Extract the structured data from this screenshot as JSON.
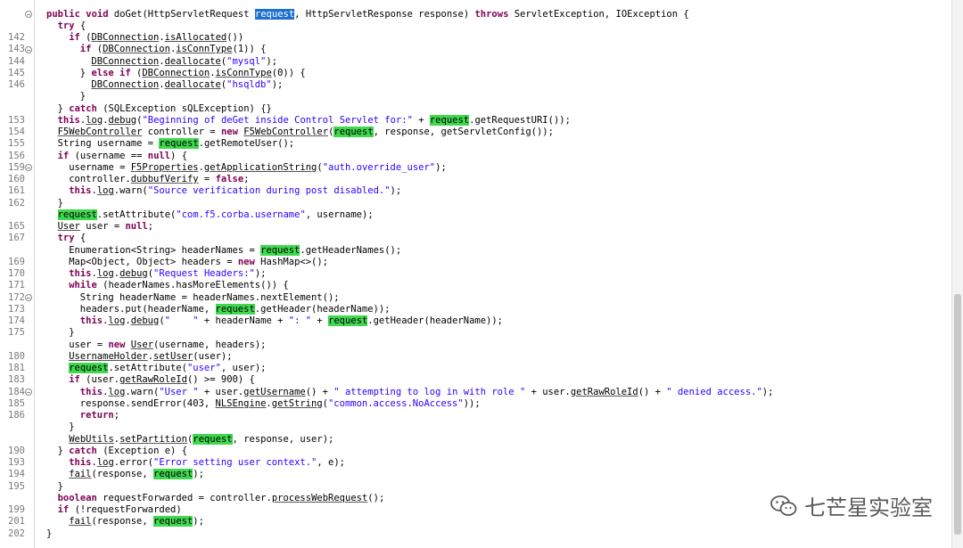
{
  "gutter": {
    "lines": [
      {
        "no": "",
        "fold": true
      },
      {
        "no": "",
        "fold": false
      },
      {
        "no": "142",
        "fold": false
      },
      {
        "no": "143",
        "fold": true
      },
      {
        "no": "144",
        "fold": false
      },
      {
        "no": "145",
        "fold": false
      },
      {
        "no": "146",
        "fold": false
      },
      {
        "no": "",
        "fold": false
      },
      {
        "no": "",
        "fold": false
      },
      {
        "no": "153",
        "fold": false
      },
      {
        "no": "154",
        "fold": false
      },
      {
        "no": "155",
        "fold": false
      },
      {
        "no": "156",
        "fold": false
      },
      {
        "no": "159",
        "fold": true
      },
      {
        "no": "160",
        "fold": false
      },
      {
        "no": "161",
        "fold": false
      },
      {
        "no": "162",
        "fold": false
      },
      {
        "no": "",
        "fold": false
      },
      {
        "no": "165",
        "fold": false
      },
      {
        "no": "167",
        "fold": false
      },
      {
        "no": "",
        "fold": false
      },
      {
        "no": "169",
        "fold": false
      },
      {
        "no": "170",
        "fold": false
      },
      {
        "no": "171",
        "fold": false
      },
      {
        "no": "172",
        "fold": true
      },
      {
        "no": "173",
        "fold": false
      },
      {
        "no": "174",
        "fold": false
      },
      {
        "no": "175",
        "fold": false
      },
      {
        "no": "",
        "fold": false
      },
      {
        "no": "180",
        "fold": false
      },
      {
        "no": "181",
        "fold": false
      },
      {
        "no": "183",
        "fold": false
      },
      {
        "no": "184",
        "fold": true
      },
      {
        "no": "185",
        "fold": false
      },
      {
        "no": "186",
        "fold": false
      },
      {
        "no": "",
        "fold": false
      },
      {
        "no": "",
        "fold": false
      },
      {
        "no": "190",
        "fold": false
      },
      {
        "no": "193",
        "fold": false
      },
      {
        "no": "194",
        "fold": false
      },
      {
        "no": "195",
        "fold": false
      },
      {
        "no": "",
        "fold": false
      },
      {
        "no": "199",
        "fold": false
      },
      {
        "no": "201",
        "fold": false
      },
      {
        "no": "202",
        "fold": false
      },
      {
        "no": "",
        "fold": false
      }
    ]
  },
  "code": {
    "rows": [
      {
        "indent": 0,
        "parts": [
          [
            "public void ",
            "k"
          ],
          [
            "doGet(HttpServletRequest ",
            ""
          ],
          [
            "request",
            "sel"
          ],
          [
            ", HttpServletResponse response) ",
            ""
          ],
          [
            "throws ",
            "k"
          ],
          [
            "ServletException, IOException {",
            ""
          ]
        ]
      },
      {
        "indent": 1,
        "parts": [
          [
            "try ",
            "k"
          ],
          [
            "{",
            ""
          ]
        ]
      },
      {
        "indent": 2,
        "parts": [
          [
            "if ",
            "k"
          ],
          [
            "(",
            ""
          ],
          [
            "DBConnection",
            "u"
          ],
          [
            ".",
            ""
          ],
          [
            "isAllocated",
            "u"
          ],
          [
            "())",
            ""
          ]
        ]
      },
      {
        "indent": 3,
        "parts": [
          [
            "if ",
            "k"
          ],
          [
            "(",
            ""
          ],
          [
            "DBConnection",
            "u"
          ],
          [
            ".",
            ""
          ],
          [
            "isConnType",
            "u"
          ],
          [
            "(1)) {",
            ""
          ]
        ]
      },
      {
        "indent": 4,
        "parts": [
          [
            "DBConnection",
            "u"
          ],
          [
            ".",
            ""
          ],
          [
            "deallocate",
            "u"
          ],
          [
            "(",
            ""
          ],
          [
            "\"mysql\"",
            "s"
          ],
          [
            ");",
            ""
          ]
        ]
      },
      {
        "indent": 3,
        "parts": [
          [
            "} ",
            ""
          ],
          [
            "else if ",
            "k"
          ],
          [
            "(",
            ""
          ],
          [
            "DBConnection",
            "u"
          ],
          [
            ".",
            ""
          ],
          [
            "isConnType",
            "u"
          ],
          [
            "(0)) {",
            ""
          ]
        ]
      },
      {
        "indent": 4,
        "parts": [
          [
            "DBConnection",
            "u"
          ],
          [
            ".",
            ""
          ],
          [
            "deallocate",
            "u"
          ],
          [
            "(",
            ""
          ],
          [
            "\"hsqldb\"",
            "s"
          ],
          [
            ");",
            ""
          ]
        ]
      },
      {
        "indent": 3,
        "parts": [
          [
            "}",
            ""
          ]
        ]
      },
      {
        "indent": 1,
        "parts": [
          [
            "} ",
            ""
          ],
          [
            "catch ",
            "k"
          ],
          [
            "(SQLException sQLException) {}",
            ""
          ]
        ]
      },
      {
        "indent": 1,
        "parts": [
          [
            "this",
            "k"
          ],
          [
            ".",
            ""
          ],
          [
            "log",
            "u"
          ],
          [
            ".",
            ""
          ],
          [
            "debug",
            "u"
          ],
          [
            "(",
            ""
          ],
          [
            "\"Beginning of deGet inside Control Servlet for:\"",
            "s"
          ],
          [
            " + ",
            ""
          ],
          [
            "request",
            "hl"
          ],
          [
            ".getRequestURI());",
            ""
          ]
        ]
      },
      {
        "indent": 1,
        "parts": [
          [
            "F5WebController",
            "u"
          ],
          [
            " controller = ",
            ""
          ],
          [
            "new ",
            "k"
          ],
          [
            "F5WebController",
            "u"
          ],
          [
            "(",
            ""
          ],
          [
            "request",
            "hl"
          ],
          [
            ", response, getServletConfig());",
            ""
          ]
        ]
      },
      {
        "indent": 1,
        "parts": [
          [
            "String username = ",
            ""
          ],
          [
            "request",
            "hl"
          ],
          [
            ".getRemoteUser();",
            ""
          ]
        ]
      },
      {
        "indent": 1,
        "parts": [
          [
            "if ",
            "k"
          ],
          [
            "(username == ",
            ""
          ],
          [
            "null",
            "k"
          ],
          [
            ") {",
            ""
          ]
        ]
      },
      {
        "indent": 2,
        "parts": [
          [
            "username = ",
            ""
          ],
          [
            "F5Properties",
            "u"
          ],
          [
            ".",
            ""
          ],
          [
            "getApplicationString",
            "u"
          ],
          [
            "(",
            ""
          ],
          [
            "\"auth.override_user\"",
            "s"
          ],
          [
            ");",
            ""
          ]
        ]
      },
      {
        "indent": 2,
        "parts": [
          [
            "controller.",
            ""
          ],
          [
            "dubbufVerify",
            "u"
          ],
          [
            " = ",
            ""
          ],
          [
            "false",
            "k"
          ],
          [
            ";",
            ""
          ]
        ]
      },
      {
        "indent": 2,
        "parts": [
          [
            "this",
            "k"
          ],
          [
            ".",
            ""
          ],
          [
            "log",
            "u"
          ],
          [
            ".warn(",
            ""
          ],
          [
            "\"Source verification during post disabled.\"",
            "s"
          ],
          [
            ");",
            ""
          ]
        ]
      },
      {
        "indent": 1,
        "parts": [
          [
            "}",
            ""
          ]
        ]
      },
      {
        "indent": 1,
        "parts": [
          [
            "request",
            "hl"
          ],
          [
            ".setAttribute(",
            ""
          ],
          [
            "\"com.f5.corba.username\"",
            "s"
          ],
          [
            ", username);",
            ""
          ]
        ]
      },
      {
        "indent": 1,
        "parts": [
          [
            "User",
            "u"
          ],
          [
            " user = ",
            ""
          ],
          [
            "null",
            "k"
          ],
          [
            ";",
            ""
          ]
        ]
      },
      {
        "indent": 1,
        "parts": [
          [
            "try ",
            "k"
          ],
          [
            "{",
            ""
          ]
        ]
      },
      {
        "indent": 2,
        "parts": [
          [
            "Enumeration<String> headerNames = ",
            ""
          ],
          [
            "request",
            "hl"
          ],
          [
            ".getHeaderNames();",
            ""
          ]
        ]
      },
      {
        "indent": 2,
        "parts": [
          [
            "Map<Object, Object> headers = ",
            ""
          ],
          [
            "new ",
            "k"
          ],
          [
            "HashMap<>();",
            ""
          ]
        ]
      },
      {
        "indent": 2,
        "parts": [
          [
            "this",
            "k"
          ],
          [
            ".",
            ""
          ],
          [
            "log",
            "u"
          ],
          [
            ".",
            ""
          ],
          [
            "debug",
            "u"
          ],
          [
            "(",
            ""
          ],
          [
            "\"Request Headers:\"",
            "s"
          ],
          [
            ");",
            ""
          ]
        ]
      },
      {
        "indent": 2,
        "parts": [
          [
            "while ",
            "k"
          ],
          [
            "(headerNames.hasMoreElements()) {",
            ""
          ]
        ]
      },
      {
        "indent": 3,
        "parts": [
          [
            "String headerName = headerNames.nextElement();",
            ""
          ]
        ]
      },
      {
        "indent": 3,
        "parts": [
          [
            "headers.put(headerName, ",
            ""
          ],
          [
            "request",
            "hl"
          ],
          [
            ".getHeader(headerName));",
            ""
          ]
        ]
      },
      {
        "indent": 3,
        "parts": [
          [
            "this",
            "k"
          ],
          [
            ".",
            ""
          ],
          [
            "log",
            "u"
          ],
          [
            ".",
            ""
          ],
          [
            "debug",
            "u"
          ],
          [
            "(",
            ""
          ],
          [
            "\"    \"",
            "s"
          ],
          [
            " + headerName + ",
            ""
          ],
          [
            "\": \"",
            "s"
          ],
          [
            " + ",
            ""
          ],
          [
            "request",
            "hl"
          ],
          [
            ".getHeader(headerName));",
            ""
          ]
        ]
      },
      {
        "indent": 2,
        "parts": [
          [
            "}",
            ""
          ]
        ]
      },
      {
        "indent": 2,
        "parts": [
          [
            "user = ",
            ""
          ],
          [
            "new ",
            "k"
          ],
          [
            "User",
            "u"
          ],
          [
            "(username, headers);",
            ""
          ]
        ]
      },
      {
        "indent": 2,
        "parts": [
          [
            "UsernameHolder",
            "u"
          ],
          [
            ".",
            ""
          ],
          [
            "setUser",
            "u"
          ],
          [
            "(user);",
            ""
          ]
        ]
      },
      {
        "indent": 2,
        "parts": [
          [
            "request",
            "hl"
          ],
          [
            ".setAttribute(",
            ""
          ],
          [
            "\"user\"",
            "s"
          ],
          [
            ", user);",
            ""
          ]
        ]
      },
      {
        "indent": 2,
        "parts": [
          [
            "if ",
            "k"
          ],
          [
            "(user.",
            ""
          ],
          [
            "getRawRoleId",
            "u"
          ],
          [
            "() >= 900) {",
            ""
          ]
        ]
      },
      {
        "indent": 3,
        "parts": [
          [
            "this",
            "k"
          ],
          [
            ".",
            ""
          ],
          [
            "log",
            "u"
          ],
          [
            ".warn(",
            ""
          ],
          [
            "\"User \"",
            "s"
          ],
          [
            " + user.",
            ""
          ],
          [
            "getUsername",
            "u"
          ],
          [
            "() + ",
            ""
          ],
          [
            "\" attempting to log in with role \"",
            "s"
          ],
          [
            " + user.",
            ""
          ],
          [
            "getRawRoleId",
            "u"
          ],
          [
            "() + ",
            ""
          ],
          [
            "\" denied access.\"",
            "s"
          ],
          [
            ");",
            ""
          ]
        ]
      },
      {
        "indent": 3,
        "parts": [
          [
            "response.sendError(403, ",
            ""
          ],
          [
            "NLSEngine",
            "u"
          ],
          [
            ".",
            ""
          ],
          [
            "getString",
            "u"
          ],
          [
            "(",
            ""
          ],
          [
            "\"common.access.NoAccess\"",
            "s"
          ],
          [
            "));",
            ""
          ]
        ]
      },
      {
        "indent": 3,
        "parts": [
          [
            "return",
            "k"
          ],
          [
            ";",
            ""
          ]
        ]
      },
      {
        "indent": 2,
        "parts": [
          [
            "}",
            ""
          ]
        ]
      },
      {
        "indent": 2,
        "parts": [
          [
            "WebUtils",
            "u"
          ],
          [
            ".",
            ""
          ],
          [
            "setPartition",
            "u"
          ],
          [
            "(",
            ""
          ],
          [
            "request",
            "hl"
          ],
          [
            ", response, user);",
            ""
          ]
        ]
      },
      {
        "indent": 1,
        "parts": [
          [
            "} ",
            ""
          ],
          [
            "catch ",
            "k"
          ],
          [
            "(Exception e) {",
            ""
          ]
        ]
      },
      {
        "indent": 2,
        "parts": [
          [
            "this",
            "k"
          ],
          [
            ".",
            ""
          ],
          [
            "log",
            "u"
          ],
          [
            ".error(",
            ""
          ],
          [
            "\"Error setting user context.\"",
            "s"
          ],
          [
            ", e);",
            ""
          ]
        ]
      },
      {
        "indent": 2,
        "parts": [
          [
            "fail",
            "u"
          ],
          [
            "(response, ",
            ""
          ],
          [
            "request",
            "hl"
          ],
          [
            ");",
            ""
          ]
        ]
      },
      {
        "indent": 1,
        "parts": [
          [
            "}",
            ""
          ]
        ]
      },
      {
        "indent": 1,
        "parts": [
          [
            "boolean ",
            "k"
          ],
          [
            "requestForwarded = controller.",
            ""
          ],
          [
            "processWebRequest",
            "u"
          ],
          [
            "();",
            ""
          ]
        ]
      },
      {
        "indent": 1,
        "parts": [
          [
            "if ",
            "k"
          ],
          [
            "(!requestForwarded)",
            ""
          ]
        ]
      },
      {
        "indent": 2,
        "parts": [
          [
            "fail",
            "u"
          ],
          [
            "(response, ",
            ""
          ],
          [
            "request",
            "hl"
          ],
          [
            ");",
            ""
          ]
        ]
      },
      {
        "indent": 0,
        "parts": [
          [
            "}",
            ""
          ]
        ]
      }
    ]
  },
  "colors": {
    "keyword": "#7f0055",
    "string": "#2a00ff",
    "occurrence_highlight": "#3fd84f",
    "selection": "#1e70cf"
  },
  "watermark": {
    "icon": "wechat-icon",
    "text": "七芒星实验室"
  }
}
